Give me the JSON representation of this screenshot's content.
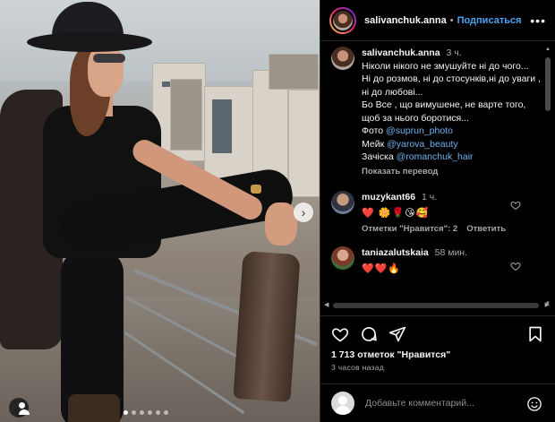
{
  "post": {
    "author": "salivanchuk.anna",
    "separator": "•",
    "follow_label": "Подписаться",
    "more_label": "•••"
  },
  "caption": {
    "username": "salivanchuk.anna",
    "time": "3 ч.",
    "lines": [
      "Ніколи нікого не змушуйте ні до чого...",
      "Ні до розмов, ні до стосунків,ні до уваги , ні до любові...",
      "Бо Все , що вимушене, не варте того, щоб за нього боротися..."
    ],
    "photo_label": "Фото",
    "photo_credit": "@suprun_photo",
    "makeup_label": "Мейк",
    "makeup_credit": "@yarova_beauty",
    "hair_label": "Зачіска",
    "hair_credit": "@romanchuk_hair",
    "translate": "Показать перевод"
  },
  "comments": [
    {
      "username": "muzykant66",
      "time": "1 ч.",
      "emojis": "❤️ 🌼🌹😘🥰",
      "likes_label": "Отметки \"Нравится\": 2",
      "reply_label": "Ответить"
    },
    {
      "username": "taniazalutskaia",
      "time": "58 мин.",
      "emojis": "❤️❤️🔥"
    }
  ],
  "footer": {
    "likes": "1 713 отметок \"Нравится\"",
    "posted_ago": "3 часов назад",
    "comment_placeholder": "Добавьте комментарий..."
  },
  "icons": {
    "like": "heart-icon",
    "comment": "comment-icon",
    "share": "share-icon",
    "save": "bookmark-icon",
    "emoji": "emoji-icon",
    "next": "chevron-right-icon",
    "tag": "user-tag-icon"
  },
  "colors": {
    "background": "#000000",
    "text": "#f5f5f5",
    "muted": "#a8a8a8",
    "link": "#6fb3ee",
    "follow": "#4aa3f0"
  },
  "carousel": {
    "count": 6,
    "active": 0
  }
}
